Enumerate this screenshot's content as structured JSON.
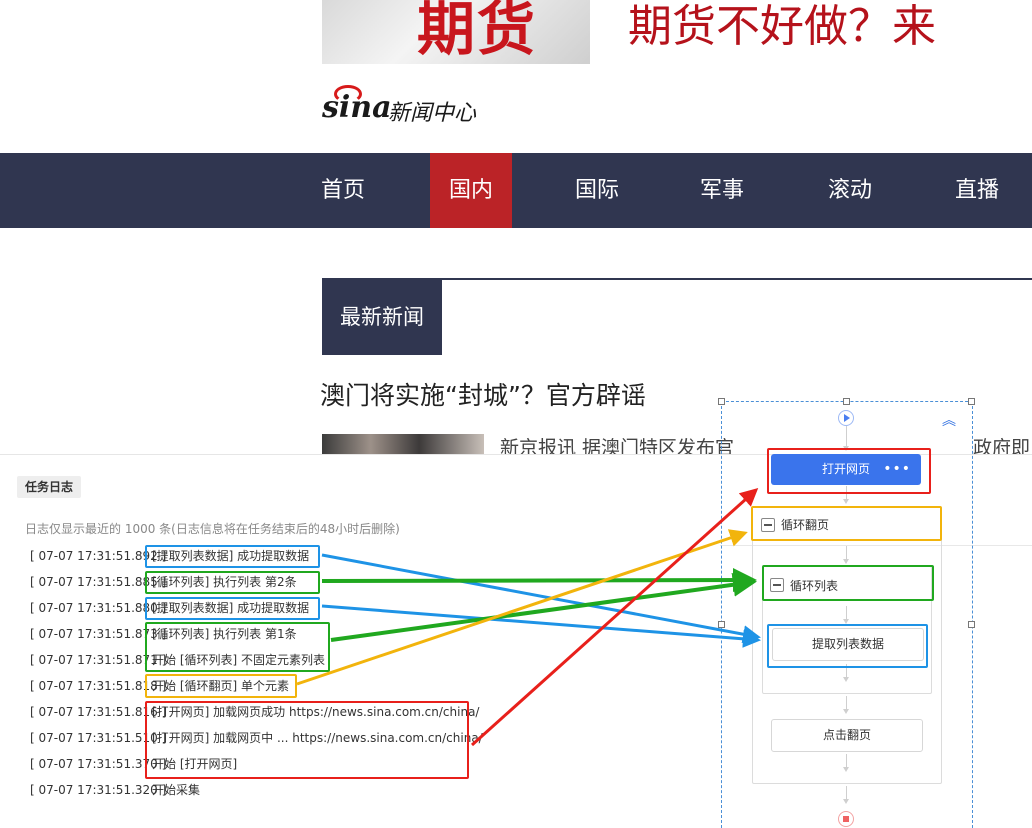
{
  "banner": {
    "word": "期货",
    "slogan": "期货不好做？来"
  },
  "logo": {
    "brand": "sina",
    "name": "新闻中心"
  },
  "nav": {
    "items": [
      {
        "label": "首页",
        "active": false
      },
      {
        "label": "国内",
        "active": true
      },
      {
        "label": "国际",
        "active": false
      },
      {
        "label": "军事",
        "active": false
      },
      {
        "label": "滚动",
        "active": false
      },
      {
        "label": "直播",
        "active": false
      }
    ]
  },
  "news": {
    "section_title": "最新新闻",
    "headline": "澳门将实施“封城”？官方辟谣",
    "snippet_left": "新京报讯 据澳门特区发布官",
    "snippet_right": "政府即"
  },
  "log": {
    "tab_label": "任务日志",
    "note": "日志仅显示最近的 1000 条(日志信息将在任务结束后的48小时后删除)",
    "lines": [
      {
        "time": "[ 07-07 17:31:51.892 ]",
        "msg": "[提取列表数据] 成功提取数据"
      },
      {
        "time": "[ 07-07 17:31:51.885 ]",
        "msg": "[循环列表] 执行列表 第2条"
      },
      {
        "time": "[ 07-07 17:31:51.880 ]",
        "msg": "[提取列表数据] 成功提取数据"
      },
      {
        "time": "[ 07-07 17:31:51.873 ]",
        "msg": "[循环列表] 执行列表 第1条"
      },
      {
        "time": "[ 07-07 17:31:51.871 ]",
        "msg": "开始 [循环列表] 不固定元素列表"
      },
      {
        "time": "[ 07-07 17:31:51.818 ]",
        "msg": "开始 [循环翻页] 单个元素"
      },
      {
        "time": "[ 07-07 17:31:51.816 ]",
        "msg": "[打开网页] 加载网页成功 https://news.sina.com.cn/china/"
      },
      {
        "time": "[ 07-07 17:31:51.510 ]",
        "msg": "[打开网页] 加载网页中 ... https://news.sina.com.cn/china/"
      },
      {
        "time": "[ 07-07 17:31:51.370 ]",
        "msg": "开始 [打开网页]"
      },
      {
        "time": "[ 07-07 17:31:51.320 ]",
        "msg": "开始采集"
      }
    ]
  },
  "flow": {
    "open_page": "打开网页",
    "open_page_more": "•••",
    "loop_page": "循环翻页",
    "loop_list": "循环列表",
    "extract_data": "提取列表数据",
    "click_next": "点击翻页",
    "collapse_glyph": "︽"
  },
  "colors": {
    "nav_bg": "#303650",
    "nav_active": "#bb2327",
    "flow_primary": "#3a74ec",
    "highlight_blue": "#1e93e6",
    "highlight_green": "#20a81f",
    "highlight_orange": "#f2b40c",
    "highlight_red": "#e8201b"
  }
}
